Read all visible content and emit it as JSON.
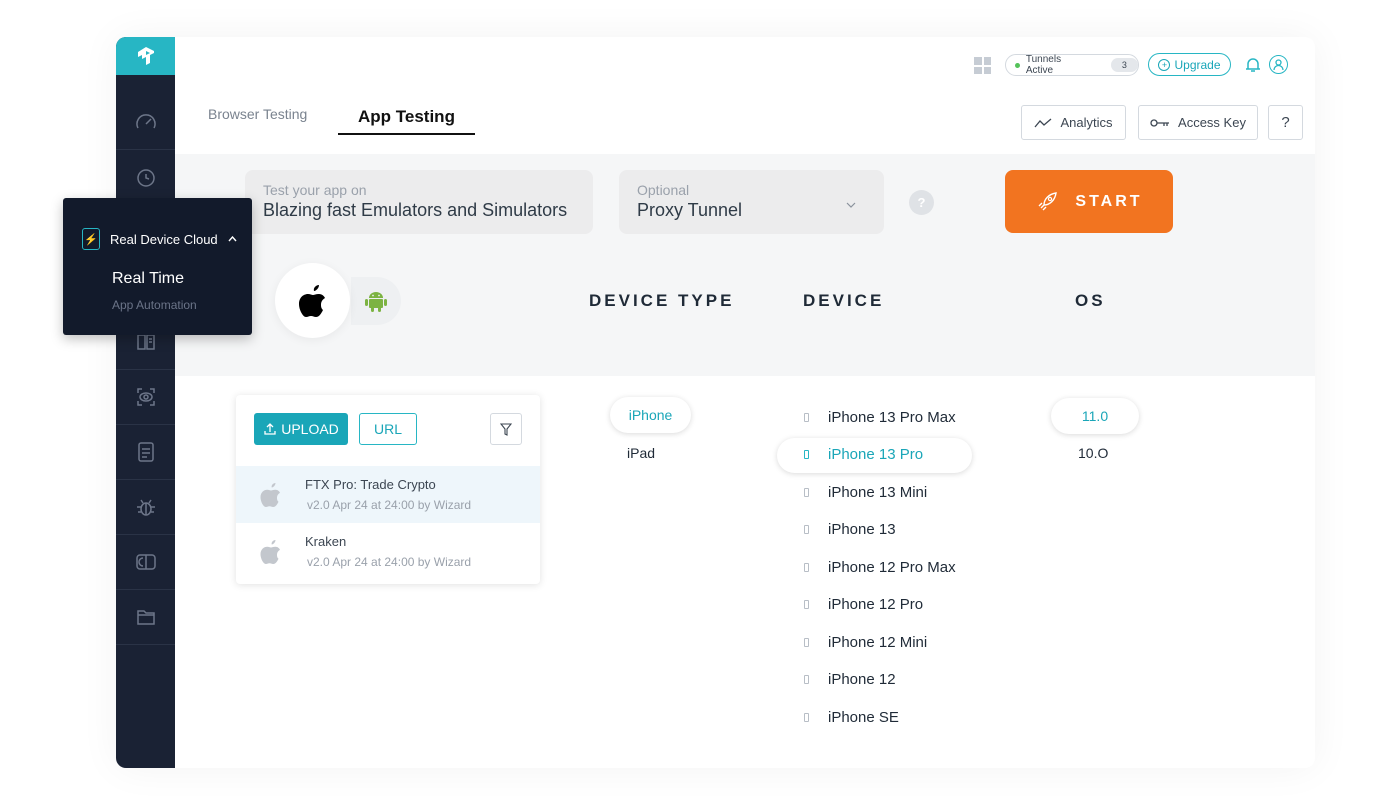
{
  "topbar": {
    "tunnels_label": "Tunnels Active",
    "tunnels_count": "3",
    "upgrade_label": "Upgrade"
  },
  "tabs": {
    "browser": "Browser Testing",
    "app": "App Testing"
  },
  "actions": {
    "analytics": "Analytics",
    "access_key": "Access Key",
    "help": "?"
  },
  "sidebar": {
    "flyout": {
      "section": "Real Device Cloud",
      "items": [
        "Real Time",
        "App Automation"
      ]
    }
  },
  "config": {
    "test_on_label": "Test your app on",
    "test_on_value": "Blazing fast Emulators and Simulators",
    "tunnel_label": "Optional",
    "tunnel_value": "Proxy Tunnel",
    "help": "?",
    "start_label": "START"
  },
  "columns": {
    "device_type": "DEVICE TYPE",
    "device": "DEVICE",
    "os": "OS"
  },
  "apps": {
    "upload_label": "UPLOAD",
    "url_label": "URL",
    "items": [
      {
        "name": "FTX Pro: Trade Crypto",
        "meta": "v2.0 Apr 24 at 24:00 by Wizard"
      },
      {
        "name": "Kraken",
        "meta": "v2.0 Apr 24 at 24:00 by Wizard"
      }
    ]
  },
  "device_types": [
    "iPhone",
    "iPad"
  ],
  "devices": [
    "iPhone 13 Pro Max",
    "iPhone 13 Pro",
    "iPhone 13 Mini",
    "iPhone 13",
    "iPhone 12 Pro Max",
    "iPhone 12 Pro",
    "iPhone 12 Mini",
    "iPhone 12",
    "iPhone SE"
  ],
  "os_versions": [
    "11.0",
    "10.O"
  ],
  "colors": {
    "accent": "#27b6c4",
    "start": "#f27420",
    "sidebar": "#1a2234"
  }
}
